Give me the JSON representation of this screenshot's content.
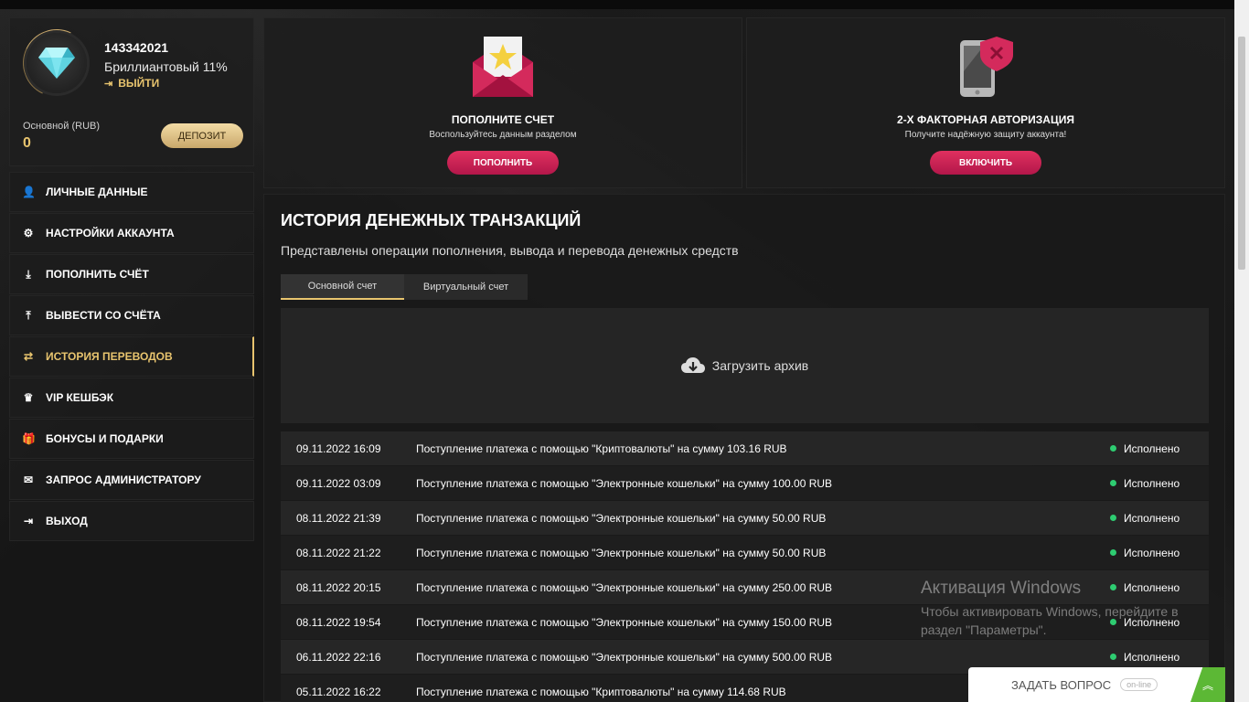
{
  "profile": {
    "user_id": "143342021",
    "level": "Бриллиантовый 11%",
    "logout_label": "ВЫЙТИ",
    "balance_label": "Основной (RUB)",
    "balance_value": "0",
    "deposit_label": "ДЕПОЗИТ"
  },
  "menu": {
    "items": [
      {
        "label": "ЛИЧНЫЕ ДАННЫЕ",
        "icon": "user-plus-icon"
      },
      {
        "label": "НАСТРОЙКИ АККАУНТА",
        "icon": "gears-icon"
      },
      {
        "label": "ПОПОЛНИТЬ СЧЁТ",
        "icon": "download-icon"
      },
      {
        "label": "ВЫВЕСТИ СО СЧЁТА",
        "icon": "upload-icon"
      },
      {
        "label": "ИСТОРИЯ ПЕРЕВОДОВ",
        "icon": "exchange-icon",
        "active": true
      },
      {
        "label": "VIP КЕШБЭК",
        "icon": "crown-icon"
      },
      {
        "label": "БОНУСЫ И ПОДАРКИ",
        "icon": "gift-icon"
      },
      {
        "label": "ЗАПРОС АДМИНИСТРАТОРУ",
        "icon": "envelope-icon"
      },
      {
        "label": "ВЫХОД",
        "icon": "sign-out-icon"
      }
    ]
  },
  "cards": {
    "deposit": {
      "title": "ПОПОЛНИТЕ СЧЕТ",
      "subtitle": "Воспользуйтесь данным разделом",
      "button": "ПОПОЛНИТЬ"
    },
    "twofa": {
      "title": "2-Х ФАКТОРНАЯ АВТОРИЗАЦИЯ",
      "subtitle": "Получите надёжную защиту аккаунта!",
      "button": "ВКЛЮЧИТЬ"
    }
  },
  "history": {
    "title": "ИСТОРИЯ ДЕНЕЖНЫХ ТРАНЗАКЦИЙ",
    "subtitle": "Представлены операции пополнения, вывода и перевода денежных средств",
    "tabs": [
      "Основной счет",
      "Виртуальный счет"
    ],
    "archive_label": "Загрузить архив",
    "rows": [
      {
        "date": "09.11.2022 16:09",
        "desc": "Поступление платежа с помощью \"Криптовалюты\" на сумму 103.16 RUB",
        "status": "Исполнено"
      },
      {
        "date": "09.11.2022 03:09",
        "desc": "Поступление платежа с помощью \"Электронные кошельки\" на сумму 100.00 RUB",
        "status": "Исполнено"
      },
      {
        "date": "08.11.2022 21:39",
        "desc": "Поступление платежа с помощью \"Электронные кошельки\" на сумму 50.00 RUB",
        "status": "Исполнено"
      },
      {
        "date": "08.11.2022 21:22",
        "desc": "Поступление платежа с помощью \"Электронные кошельки\" на сумму 50.00 RUB",
        "status": "Исполнено"
      },
      {
        "date": "08.11.2022 20:15",
        "desc": "Поступление платежа с помощью \"Электронные кошельки\" на сумму 250.00 RUB",
        "status": "Исполнено"
      },
      {
        "date": "08.11.2022 19:54",
        "desc": "Поступление платежа с помощью \"Электронные кошельки\" на сумму 150.00 RUB",
        "status": "Исполнено"
      },
      {
        "date": "06.11.2022 22:16",
        "desc": "Поступление платежа с помощью \"Электронные кошельки\" на сумму 500.00 RUB",
        "status": "Исполнено"
      },
      {
        "date": "05.11.2022 16:22",
        "desc": "Поступление платежа с помощью \"Криптовалюты\" на сумму 114.68 RUB",
        "status": ""
      }
    ]
  },
  "watermark": {
    "title": "Активация Windows",
    "text": "Чтобы активировать Windows, перейдите в раздел \"Параметры\"."
  },
  "chat": {
    "label": "ЗАДАТЬ ВОПРОС",
    "status": "on-line"
  }
}
